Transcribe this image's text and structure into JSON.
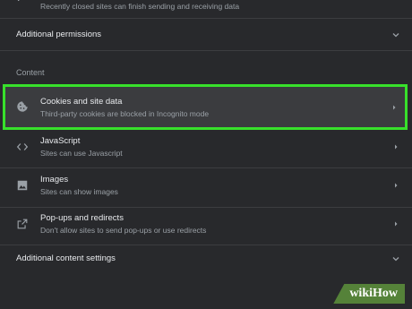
{
  "top_row": {
    "subtitle": "Recently closed sites can finish sending and receiving data"
  },
  "additional_permissions": {
    "label": "Additional permissions"
  },
  "content_section": {
    "label": "Content"
  },
  "items": [
    {
      "title": "Cookies and site data",
      "subtitle": "Third-party cookies are blocked in Incognito mode",
      "icon": "cookie-icon"
    },
    {
      "title": "JavaScript",
      "subtitle": "Sites can use Javascript",
      "icon": "code-icon"
    },
    {
      "title": "Images",
      "subtitle": "Sites can show images",
      "icon": "image-icon"
    },
    {
      "title": "Pop-ups and redirects",
      "subtitle": "Don't allow sites to send pop-ups or use redirects",
      "icon": "popup-icon"
    }
  ],
  "additional_content": {
    "label": "Additional content settings"
  },
  "watermark": {
    "part1": "wiki",
    "part2": "How"
  },
  "colors": {
    "highlight": "#38e02b",
    "background": "#28292c"
  }
}
